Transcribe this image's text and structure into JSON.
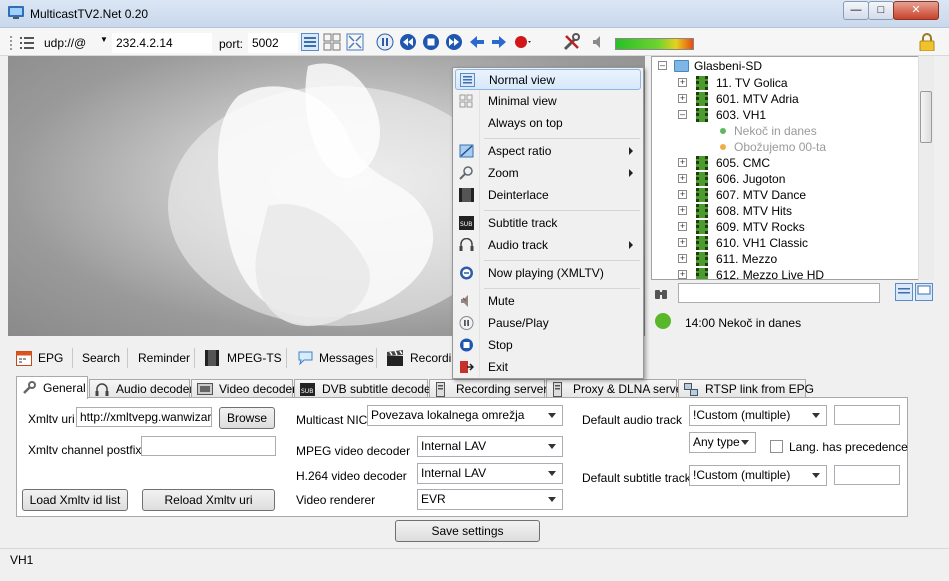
{
  "window": {
    "title": "MulticastTV2.Net 0.20"
  },
  "toolbar": {
    "protocol": "udp://@",
    "address": "232.4.2.14",
    "port_label": "port:",
    "port": "5002"
  },
  "channel_tree": {
    "root": "Glasbeni-SD",
    "items": [
      {
        "label": "11. TV Golica",
        "kind": "channel",
        "expanded": false
      },
      {
        "label": "601. MTV Adria",
        "kind": "channel",
        "expanded": false
      },
      {
        "label": "603. VH1",
        "kind": "channel",
        "expanded": true
      },
      {
        "label": "Nekoč in danes",
        "kind": "program",
        "color": "#5cb85c"
      },
      {
        "label": "Obožujemo 00-ta",
        "kind": "program",
        "color": "#f0ad4e"
      },
      {
        "label": "605. CMC",
        "kind": "channel",
        "expanded": false
      },
      {
        "label": "606. Jugoton",
        "kind": "channel",
        "expanded": false
      },
      {
        "label": "607. MTV Dance",
        "kind": "channel",
        "expanded": false
      },
      {
        "label": "608. MTV Hits",
        "kind": "channel",
        "expanded": false
      },
      {
        "label": "609. MTV Rocks",
        "kind": "channel",
        "expanded": false
      },
      {
        "label": "610. VH1 Classic",
        "kind": "channel",
        "expanded": false
      },
      {
        "label": "611. Mezzo",
        "kind": "channel",
        "expanded": false
      },
      {
        "label": "612. Mezzo Live HD",
        "kind": "channel",
        "expanded": false
      }
    ]
  },
  "now_playing": "14:00 Nekoč in danes",
  "bottom_tabs": [
    "EPG",
    "Search",
    "Reminder",
    "MPEG-TS",
    "Messages",
    "Recordin"
  ],
  "settings_tabs": [
    "General",
    "Audio decoder",
    "Video decoder",
    "DVB subtitle decoder",
    "Recording server",
    "Proxy & DLNA server",
    "RTSP link from EPG"
  ],
  "general": {
    "xmltv_uri_label": "Xmltv uri",
    "xmltv_uri": "http://xmltvepg.wanwizard.",
    "browse": "Browse",
    "postfix_label": "Xmltv channel postfix",
    "postfix_value": "",
    "load_ids": "Load Xmltv id list",
    "reload": "Reload Xmltv uri",
    "nic_label": "Multicast NIC",
    "nic": "Povezava lokalnega omrežja",
    "mpeg_label": "MPEG video decoder",
    "mpeg": "Internal LAV",
    "h264_label": "H.264 video decoder",
    "h264": "Internal LAV",
    "renderer_label": "Video renderer",
    "renderer": "EVR",
    "audio_track_label": "Default audio track",
    "audio_track": "!Custom (multiple)",
    "audio_track_extra": "",
    "any_type": "Any type",
    "lang_precedence": "Lang. has precedence",
    "subtitle_label": "Default subtitle track",
    "subtitle": "!Custom (multiple)",
    "subtitle_extra": ""
  },
  "save": "Save settings",
  "status": "VH1",
  "context_menu": [
    {
      "label": "Normal view",
      "icon": "normal-view-icon",
      "highlighted": true
    },
    {
      "label": "Minimal view",
      "icon": "minimal-view-icon"
    },
    {
      "label": "Always on top",
      "icon": ""
    },
    {
      "separator": true
    },
    {
      "label": "Aspect ratio",
      "icon": "aspect-ratio-icon",
      "submenu": true
    },
    {
      "label": "Zoom",
      "icon": "zoom-icon",
      "submenu": true
    },
    {
      "label": "Deinterlace",
      "icon": "deinterlace-icon"
    },
    {
      "separator": true
    },
    {
      "label": "Subtitle track",
      "icon": "subtitle-icon"
    },
    {
      "label": "Audio track",
      "icon": "headphones-icon",
      "submenu": true
    },
    {
      "separator": true
    },
    {
      "label": "Now playing (XMLTV)",
      "icon": "now-playing-icon"
    },
    {
      "separator": true
    },
    {
      "label": "Mute",
      "icon": "mute-icon"
    },
    {
      "label": "Pause/Play",
      "icon": "pause-icon"
    },
    {
      "label": "Stop",
      "icon": "stop-icon"
    },
    {
      "label": "Exit",
      "icon": "exit-icon"
    }
  ]
}
